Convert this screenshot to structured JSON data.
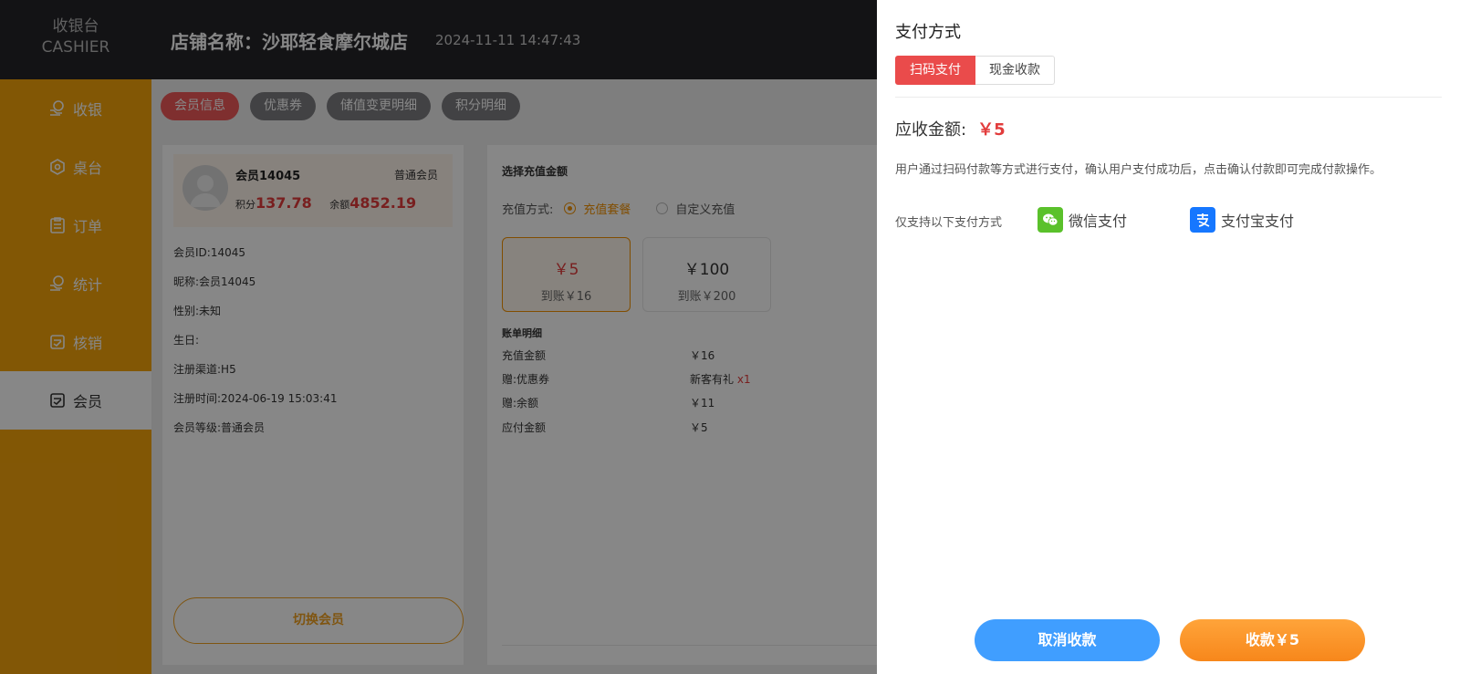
{
  "brand": {
    "line1": "收银台",
    "line2": "CASHIER"
  },
  "header": {
    "store_name": "店铺名称：沙耶轻食摩尔城店",
    "datetime": "2024-11-11 14:47:43"
  },
  "sidebar": {
    "items": [
      {
        "label": "收银",
        "icon": "cashier-icon"
      },
      {
        "label": "桌台",
        "icon": "table-icon"
      },
      {
        "label": "订单",
        "icon": "order-icon"
      },
      {
        "label": "统计",
        "icon": "statistics-icon"
      },
      {
        "label": "核销",
        "icon": "verify-icon"
      },
      {
        "label": "会员",
        "icon": "member-icon",
        "active": true
      }
    ]
  },
  "tabs": [
    "会员信息",
    "优惠券",
    "储值变更明细",
    "积分明细"
  ],
  "member": {
    "name": "会员14045",
    "level": "普通会员",
    "points_label": "积分",
    "points": "137.78",
    "balance_label": "余额",
    "balance": "4852.19",
    "info": [
      "会员ID:14045",
      "昵称:会员14045",
      "性别:未知",
      "生日:",
      "注册渠道:H5",
      "注册时间:2024-06-19 15:03:41",
      "会员等级:普通会员"
    ],
    "switch_label": "切换会员"
  },
  "recharge": {
    "title": "选择充值金额",
    "method_label": "充值方式:",
    "option_package": "充值套餐",
    "option_custom": "自定义充值",
    "packages": [
      {
        "price": "￥5",
        "receive": "到账￥16",
        "selected": true
      },
      {
        "price": "￥100",
        "receive": "到账￥200",
        "selected": false
      }
    ],
    "bill_title": "账单明细",
    "bill": [
      {
        "label": "充值金额",
        "value": "￥16"
      },
      {
        "label": "赠:优惠券",
        "value": "新客有礼",
        "extra": "x1"
      },
      {
        "label": "赠:余额",
        "value": "￥11"
      },
      {
        "label": "应付金额",
        "value": "￥5"
      }
    ]
  },
  "drawer": {
    "title": "支付方式",
    "tab_scan": "扫码支付",
    "tab_cash": "现金收款",
    "amount_label": "应收金额:",
    "amount_value": "￥5",
    "description": "用户通过扫码付款等方式进行支付，确认用户支付成功后，点击确认付款即可完成付款操作。",
    "methods_label": "仅支持以下支付方式",
    "wechat": "微信支付",
    "alipay": "支付宝支付",
    "cancel": "取消收款",
    "confirm": "收款￥5"
  },
  "colors": {
    "sidebar": "#f5a50b",
    "header": "#242428",
    "accent_red": "#e23c3c",
    "wechat": "#5ac12b",
    "alipay": "#1677ff",
    "cancel_button": "#409eff",
    "confirm_button": "#f7871b"
  }
}
